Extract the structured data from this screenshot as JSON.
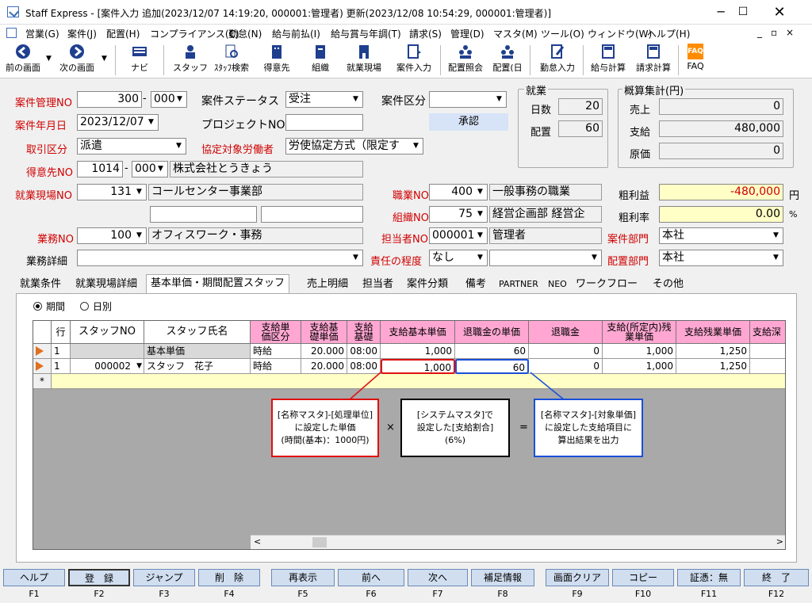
{
  "window": {
    "title": "Staff Express - [案件入力 追加(2023/12/07 14:19:20, 000001:管理者) 更新(2023/12/08 10:54:29, 000001:管理者)]"
  },
  "menu": [
    "営業(G)",
    "案件(J)",
    "配置(H)",
    "コンプライアンス(C)",
    "勤怠(N)",
    "給与前払(I)",
    "給与賞与年調(T)",
    "請求(S)",
    "管理(D)",
    "マスタ(M)",
    "ツール(O)",
    "ウィンドウ(W)",
    "ヘルプ(H)"
  ],
  "toolbar": [
    "前の画面",
    "次の画面",
    "ナビ",
    "スタッフ",
    "ｽﾀｯﾌ検索",
    "得意先",
    "組織",
    "就業現場",
    "案件入力",
    "配置照会",
    "配置(日",
    "勤怠入力",
    "給与計算",
    "請求計算",
    "FAQ"
  ],
  "form": {
    "case_no_label": "案件管理NO",
    "case_no": "300",
    "case_no_sub": "000",
    "status_label": "案件ステータス",
    "status": "受注",
    "category_label": "案件区分",
    "category": "",
    "ym_label": "案件年月日",
    "ym": "2023/12/07",
    "project_label": "プロジェクトNO",
    "project": "",
    "approve": "承認",
    "trade_label": "取引区分",
    "trade": "派遣",
    "agreement_label": "協定対象労働者",
    "agreement": "労使協定方式（限定す",
    "customer_label": "得意先NO",
    "customer_no": "1014",
    "customer_sub": "000",
    "customer_name": "株式会社とうきょう",
    "site_label": "就業現場NO",
    "site_no": "131",
    "site_name": "コールセンター事業部",
    "job_label": "職業NO",
    "job_no": "400",
    "job_name": "一般事務の職業",
    "org_label": "組織NO",
    "org_no": "75",
    "org_name": "経営企画部 経営企",
    "work_label": "業務NO",
    "work_no": "100",
    "work_name": "オフィスワーク・事務",
    "person_label": "担当者NO",
    "person_no": "000001",
    "person_name": "管理者",
    "case_dept_label": "案件部門",
    "case_dept": "本社",
    "detail_label": "業務詳細",
    "detail": "",
    "resp_label": "責任の程度",
    "resp": "なし",
    "resp2": "",
    "place_dept_label": "配置部門",
    "place_dept": "本社"
  },
  "shugyo": {
    "title": "就業",
    "days_label": "日数",
    "days": "20",
    "place_label": "配置",
    "place": "60"
  },
  "summary": {
    "title": "概算集計(円)",
    "sales_label": "売上",
    "sales": "0",
    "pay_label": "支給",
    "pay": "480,000",
    "cost_label": "原価",
    "cost": "0",
    "gross_label": "粗利益",
    "gross": "-480,000",
    "gross_unit": "円",
    "rate_label": "粗利率",
    "rate": "0.00",
    "rate_unit": "%"
  },
  "tabs": [
    "就業条件",
    "就業現場詳細",
    "基本単価・期間配置スタッフ",
    "売上明細",
    "担当者",
    "案件分類",
    "備考",
    "PARTNER",
    "NEO",
    "ワークフロー",
    "その他"
  ],
  "radio": {
    "period": "期間",
    "daily": "日別"
  },
  "grid": {
    "headers": [
      "行",
      "スタッフNO",
      "スタッフ氏名",
      "支給単価区分",
      "支給基礎単価",
      "支給基礎",
      "支給基本単価",
      "退職金の単価",
      "退職金",
      "支給(所定内)残業単価",
      "支給残業単価",
      "支給深"
    ],
    "rows": [
      [
        "1",
        "",
        "基本単価",
        "時給",
        "20.000",
        "08:00",
        "1,000",
        "60",
        "0",
        "1,000",
        "1,250",
        ""
      ],
      [
        "1",
        "000002",
        "スタッフ　花子",
        "時給",
        "20.000",
        "08:00",
        "1,000",
        "60",
        "0",
        "1,000",
        "1,250",
        ""
      ]
    ],
    "new_row": "*"
  },
  "notes": {
    "left": [
      "[名称マスタ]-[処理単位]",
      "に設定した単価",
      "(時間(基本)：1000円)"
    ],
    "mid": [
      "[システムマスタ]で",
      "設定した[支給割合]",
      "(6%)"
    ],
    "right": [
      "[名称マスタ]-[対象単価]",
      "に設定した支給項目に",
      "算出結果を出力"
    ],
    "times": "×",
    "equals": "="
  },
  "fkeys": [
    [
      "ヘルプ",
      "F1"
    ],
    [
      "登　録",
      "F2"
    ],
    [
      "ジャンプ",
      "F3"
    ],
    [
      "削　除",
      "F4"
    ],
    [
      "再表示",
      "F5"
    ],
    [
      "前へ",
      "F6"
    ],
    [
      "次へ",
      "F7"
    ],
    [
      "補足情報",
      "F8"
    ],
    [
      "画面クリア",
      "F9"
    ],
    [
      "コピー",
      "F10"
    ],
    [
      "証憑：無",
      "F11"
    ],
    [
      "終　了",
      "F12"
    ]
  ]
}
